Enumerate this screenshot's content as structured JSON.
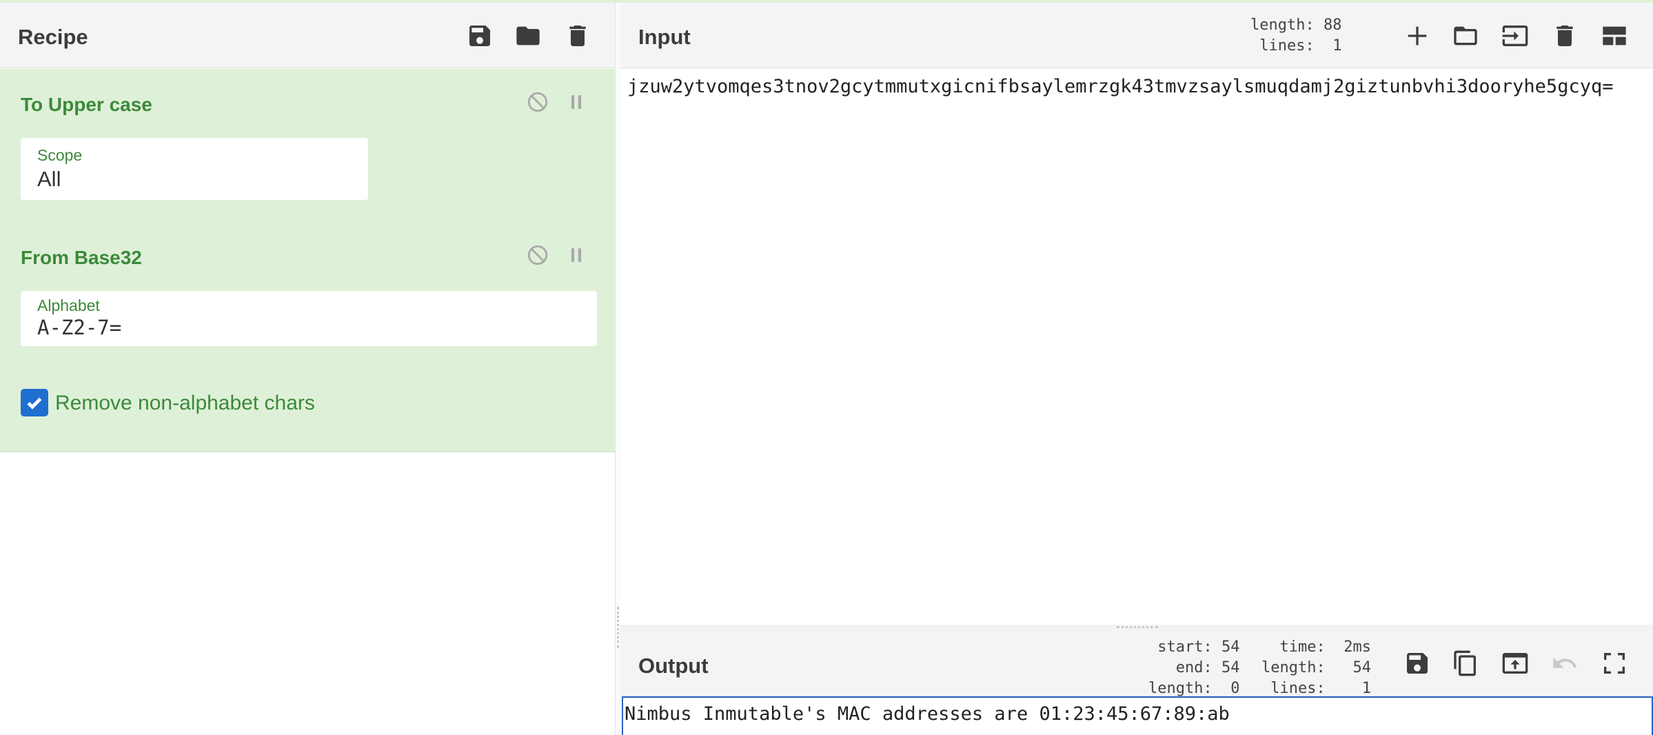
{
  "recipe": {
    "title": "Recipe",
    "operations": [
      {
        "name": "To Upper case",
        "fields": [
          {
            "label": "Scope",
            "value": "All"
          }
        ]
      },
      {
        "name": "From Base32",
        "fields": [
          {
            "label": "Alphabet",
            "value": "A-Z2-7="
          }
        ],
        "checkbox": {
          "label": "Remove non-alphabet chars",
          "checked": true
        }
      }
    ]
  },
  "input": {
    "title": "Input",
    "stats": "length: 88\n lines:  1",
    "text": "jzuw2ytvomqes3tnov2gcytmmutxgicnifbsaylemrzgk43tmvzsaylsmuqdamj2giztunbvhi3dooryhe5gcyq="
  },
  "output": {
    "title": "Output",
    "stats_left": "start: 54\n  end: 54\nlength:  0",
    "stats_right": "  time:  2ms\nlength:   54\n lines:    1",
    "text": "Nimbus Inmutable's MAC addresses are 01:23:45:67:89:ab"
  },
  "colors": {
    "accent": "#3b8a3a",
    "operation_bg": "#dff0d8",
    "checkbox": "#1f6fd1",
    "output_border": "#2b63c4"
  }
}
